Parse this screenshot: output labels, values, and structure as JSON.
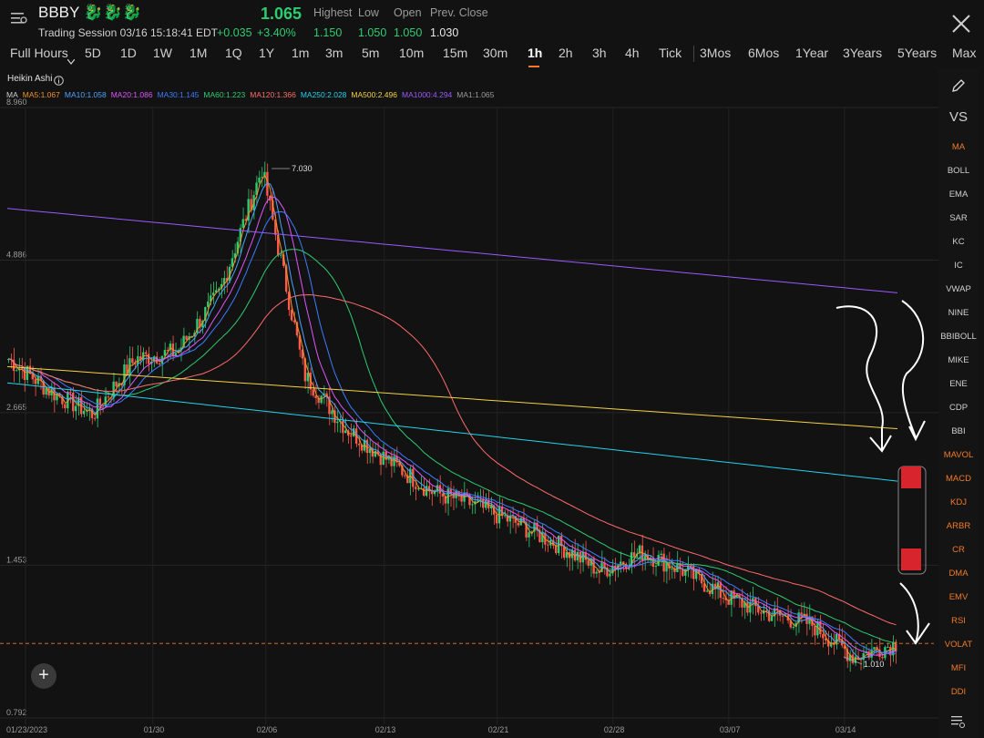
{
  "header": {
    "ticker": "BBBY 🐉🐉🐉",
    "session": "Trading Session 03/16 15:18:41 EDT",
    "price": "1.065",
    "change": "+0.035",
    "change_pct": "+3.40%",
    "stats": [
      {
        "label": "Highest",
        "value": "1.150"
      },
      {
        "label": "Low",
        "value": "1.050"
      },
      {
        "label": "Open",
        "value": "1.050"
      },
      {
        "label": "Prev. Close",
        "value": "1.030"
      }
    ],
    "close_icon": "close-icon",
    "menu_icon": "menu-icon"
  },
  "tabs": [
    "Full Hours",
    "5D",
    "1D",
    "1W",
    "1M",
    "1Q",
    "1Y",
    "1m",
    "3m",
    "5m",
    "10m",
    "15m",
    "30m",
    "1h",
    "2h",
    "3h",
    "4h",
    "Tick",
    "3Mos",
    "6Mos",
    "1Year",
    "3Years",
    "5Years",
    "Max"
  ],
  "active_tab": "1h",
  "chart_type_label": "Heikin Ashi",
  "ma_legend": [
    {
      "label": "MA",
      "color": "#d0d0d0"
    },
    {
      "label": "MA5:1.067",
      "color": "#f0932b"
    },
    {
      "label": "MA10:1.058",
      "color": "#4aa3ff"
    },
    {
      "label": "MA20:1.086",
      "color": "#e056fd"
    },
    {
      "label": "MA30:1.145",
      "color": "#3d7bff"
    },
    {
      "label": "MA60:1.223",
      "color": "#2ecc71"
    },
    {
      "label": "MA120:1.366",
      "color": "#ff6b6b"
    },
    {
      "label": "MA250:2.028",
      "color": "#22d3ee"
    },
    {
      "label": "MA500:2.496",
      "color": "#f5d142"
    },
    {
      "label": "MA1000:4.294",
      "color": "#9b59ff"
    },
    {
      "label": "MA1:1.065",
      "color": "#9a9a9a"
    }
  ],
  "right_panel": {
    "top_items": [
      "VS"
    ],
    "indicators": [
      {
        "label": "MA",
        "active": true
      },
      {
        "label": "BOLL",
        "active": false
      },
      {
        "label": "EMA",
        "active": false
      },
      {
        "label": "SAR",
        "active": false
      },
      {
        "label": "KC",
        "active": false
      },
      {
        "label": "IC",
        "active": false
      },
      {
        "label": "VWAP",
        "active": false
      },
      {
        "label": "NINE",
        "active": false
      },
      {
        "label": "BBIBOLL",
        "active": false
      },
      {
        "label": "MIKE",
        "active": false
      },
      {
        "label": "ENE",
        "active": false
      },
      {
        "label": "CDP",
        "active": false
      },
      {
        "label": "BBI",
        "active": false
      },
      {
        "label": "MAVOL",
        "active": true
      },
      {
        "label": "MACD",
        "active": true
      },
      {
        "label": "KDJ",
        "active": true
      },
      {
        "label": "ARBR",
        "active": true
      },
      {
        "label": "CR",
        "active": true
      },
      {
        "label": "DMA",
        "active": true
      },
      {
        "label": "EMV",
        "active": true
      },
      {
        "label": "RSI",
        "active": true
      },
      {
        "label": "VOLAT",
        "active": true
      },
      {
        "label": "MFI",
        "active": true
      },
      {
        "label": "DDI",
        "active": true
      }
    ]
  },
  "chart_data": {
    "type": "candlestick",
    "scale": "log",
    "y_ticks": [
      "8.960",
      "4.886",
      "2.665",
      "1.453",
      "0.792"
    ],
    "x_ticks": [
      "01/23/2023",
      "01/30",
      "02/06",
      "02/13",
      "02/21",
      "02/28",
      "03/07",
      "03/14"
    ],
    "annotations": [
      {
        "label": "7.030",
        "value": 7.03,
        "kind": "high"
      },
      {
        "label": "1.010",
        "value": 1.01,
        "kind": "low"
      }
    ],
    "last_price": 1.065,
    "series_close_approx": [
      {
        "x": "01/23/2023",
        "y": 3.3
      },
      {
        "x": "01/27",
        "y": 2.9
      },
      {
        "x": "01/30",
        "y": 2.65
      },
      {
        "x": "02/01",
        "y": 3.3
      },
      {
        "x": "02/03",
        "y": 3.4
      },
      {
        "x": "02/06",
        "y": 4.3
      },
      {
        "x": "02/07",
        "y": 7.03
      },
      {
        "x": "02/08",
        "y": 3.1
      },
      {
        "x": "02/10",
        "y": 2.5
      },
      {
        "x": "02/13",
        "y": 2.2
      },
      {
        "x": "02/15",
        "y": 1.95
      },
      {
        "x": "02/17",
        "y": 1.85
      },
      {
        "x": "02/21",
        "y": 1.72
      },
      {
        "x": "02/23",
        "y": 1.58
      },
      {
        "x": "02/28",
        "y": 1.42
      },
      {
        "x": "03/02",
        "y": 1.53
      },
      {
        "x": "03/06",
        "y": 1.42
      },
      {
        "x": "03/08",
        "y": 1.28
      },
      {
        "x": "03/10",
        "y": 1.2
      },
      {
        "x": "03/13",
        "y": 1.15
      },
      {
        "x": "03/15",
        "y": 1.01
      },
      {
        "x": "03/16",
        "y": 1.065
      }
    ]
  },
  "add_button": "+"
}
